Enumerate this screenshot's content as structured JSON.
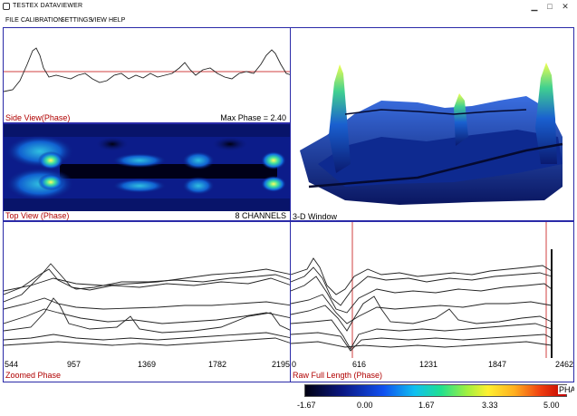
{
  "window": {
    "title": "TESTEX DATAVIEWER",
    "min_glyph": "▁",
    "max_glyph": "□",
    "close_glyph": "✕"
  },
  "menu": [
    "FILE",
    "CALIBRATION",
    "SETTINGS",
    "VIEW",
    "HELP"
  ],
  "side_view": {
    "label": "Side View(Phase)",
    "max_phase": "Max Phase = 2.40"
  },
  "top_view": {
    "label": "Top View (Phase)",
    "channels": "8 CHANNELS"
  },
  "three_d": {
    "label": "3-D Window"
  },
  "zoomed": {
    "label": "Zoomed Phase",
    "ticks": [
      "544",
      "957",
      "1369",
      "1782",
      "2195"
    ]
  },
  "raw": {
    "label": "Raw Full Length (Phase)",
    "ticks": [
      "0",
      "616",
      "1231",
      "1847",
      "2462"
    ]
  },
  "colorbar": {
    "title": "PHASE",
    "ticks": [
      "-1.67",
      "0.00",
      "1.67",
      "3.33",
      "5.00"
    ]
  },
  "colors": {
    "panel_border": "#2a2aa8",
    "label_red": "#b00000",
    "threshold_line": "#d04040"
  }
}
